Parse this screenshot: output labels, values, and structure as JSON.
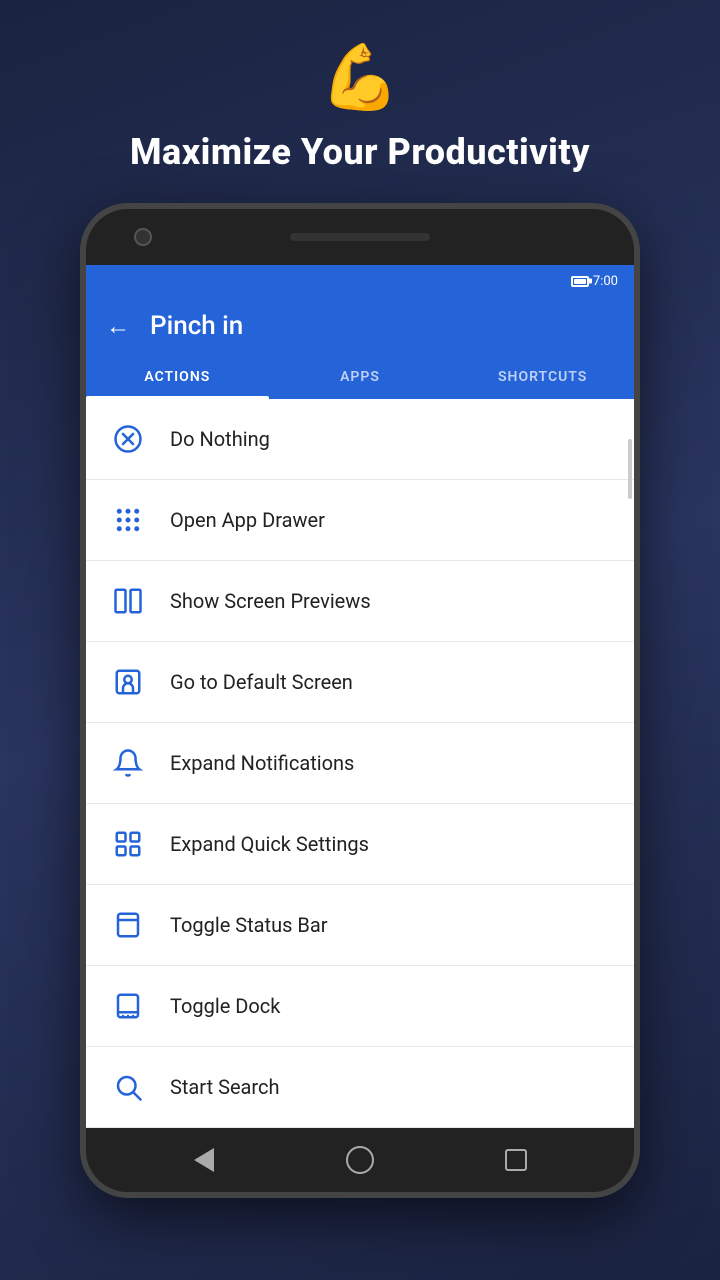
{
  "page": {
    "emoji": "💪",
    "headline": "Maximize Your Productivity"
  },
  "status_bar": {
    "time": "7:00"
  },
  "app_bar": {
    "title": "Pinch in",
    "back_label": "←"
  },
  "tabs": [
    {
      "id": "actions",
      "label": "ACTIONS",
      "active": true
    },
    {
      "id": "apps",
      "label": "APPS",
      "active": false
    },
    {
      "id": "shortcuts",
      "label": "SHORTCUTS",
      "active": false
    }
  ],
  "actions": [
    {
      "id": "do-nothing",
      "label": "Do Nothing",
      "icon": "x-circle"
    },
    {
      "id": "open-app-drawer",
      "label": "Open App Drawer",
      "icon": "grid"
    },
    {
      "id": "show-screen-previews",
      "label": "Show Screen Previews",
      "icon": "columns"
    },
    {
      "id": "go-to-default-screen",
      "label": "Go to Default Screen",
      "icon": "home-screen"
    },
    {
      "id": "expand-notifications",
      "label": "Expand Notifications",
      "icon": "bell"
    },
    {
      "id": "expand-quick-settings",
      "label": "Expand Quick Settings",
      "icon": "quick-settings"
    },
    {
      "id": "toggle-status-bar",
      "label": "Toggle Status Bar",
      "icon": "status-bar"
    },
    {
      "id": "toggle-dock",
      "label": "Toggle Dock",
      "icon": "dock"
    },
    {
      "id": "start-search",
      "label": "Start Search",
      "icon": "search"
    }
  ]
}
